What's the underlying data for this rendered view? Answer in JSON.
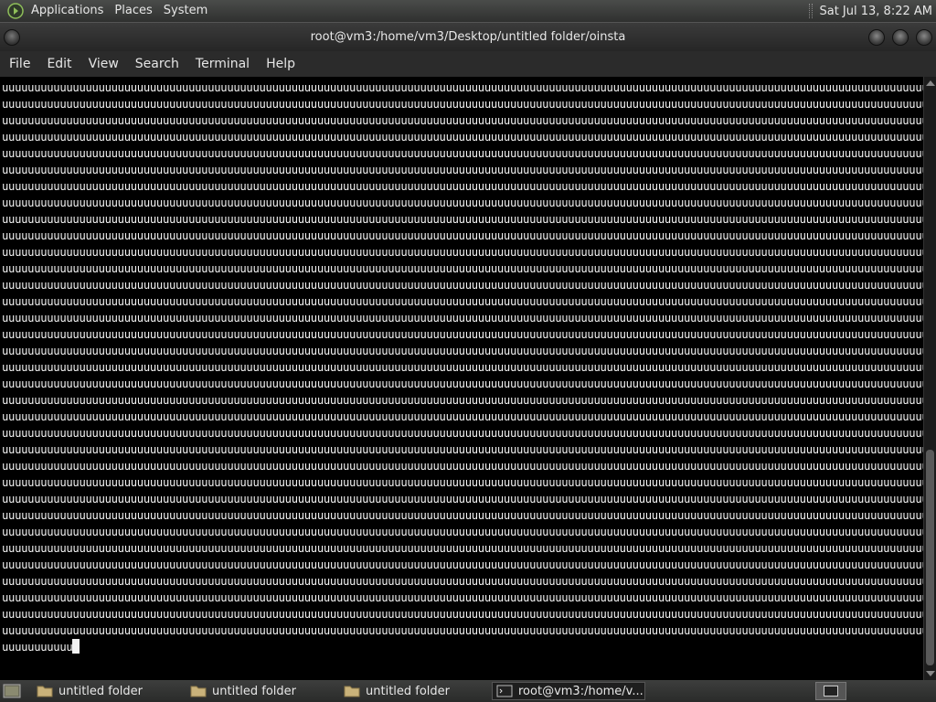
{
  "top_panel": {
    "menus": [
      {
        "label": "Applications"
      },
      {
        "label": "Places"
      },
      {
        "label": "System"
      }
    ],
    "clock": "Sat Jul 13,  8:22 AM"
  },
  "window": {
    "title": "root@vm3:/home/vm3/Desktop/untitled folder/oinsta"
  },
  "menubar": {
    "items": [
      {
        "label": "File"
      },
      {
        "label": "Edit"
      },
      {
        "label": "View"
      },
      {
        "label": "Search"
      },
      {
        "label": "Terminal"
      },
      {
        "label": "Help"
      }
    ]
  },
  "terminal": {
    "full_line": "uuuuuuuuuuuuuuuuuuuuuuuuuuuuuuuuuuuuuuuuuuuuuuuuuuuuuuuuuuuuuuuuuuuuuuuuuuuuuuuuuuuuuuuuuuuuuuuuuuuuuuuuuuuuuuuuuuuuuuuuuuuuuuuuuuuuuuuuuuuuuuuuuuuuuuuuuuuuuu",
    "last_line": "uuuuuuuuuuu",
    "line_count": 35
  },
  "taskbar": {
    "tasks": [
      {
        "label": "untitled folder",
        "icon": "folder-icon",
        "active": false
      },
      {
        "label": "untitled folder",
        "icon": "folder-icon",
        "active": false
      },
      {
        "label": "untitled folder",
        "icon": "folder-icon",
        "active": false
      },
      {
        "label": "root@vm3:/home/v...",
        "icon": "terminal-icon",
        "active": true
      }
    ]
  },
  "colors": {
    "panel_bg": "#3a3b3a",
    "terminal_bg": "#000000",
    "terminal_fg": "#f2f2f2",
    "folder_icon": "#c9b27a"
  }
}
